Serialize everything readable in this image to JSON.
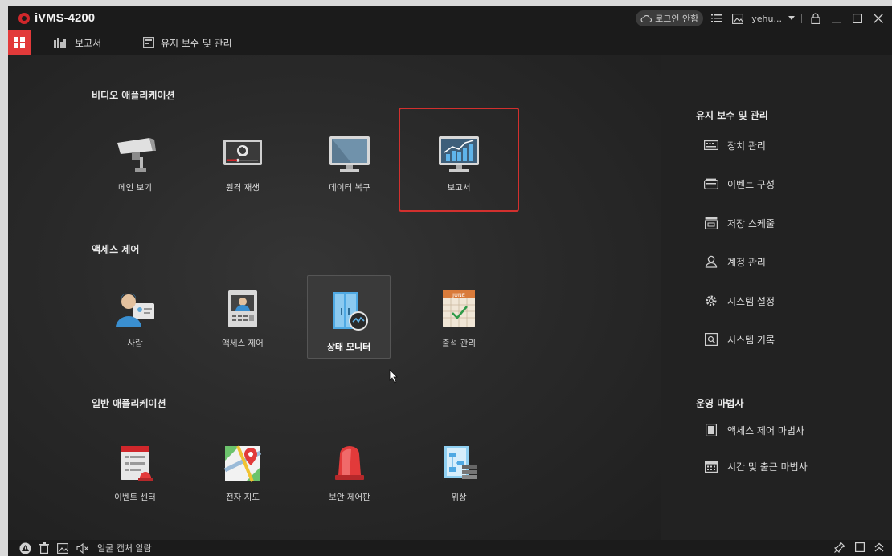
{
  "app": {
    "title": "iVMS-4200"
  },
  "titlebar": {
    "login_label": "로그인 안함",
    "user_label": "yehu..."
  },
  "menu": {
    "items": [
      {
        "label": "보고서"
      },
      {
        "label": "유지 보수 및 관리"
      }
    ]
  },
  "sections": {
    "video": {
      "title": "비디오 애플리케이션",
      "tiles": [
        {
          "label": "메인 보기"
        },
        {
          "label": "원격 재생"
        },
        {
          "label": "데이터 복구"
        },
        {
          "label": "보고서"
        }
      ]
    },
    "access": {
      "title": "액세스 제어",
      "tiles": [
        {
          "label": "사람"
        },
        {
          "label": "액세스 제어"
        },
        {
          "label": "상태 모니터"
        },
        {
          "label": "출석 관리"
        }
      ]
    },
    "general": {
      "title": "일반 애플리케이션",
      "tiles": [
        {
          "label": "이벤트 센터"
        },
        {
          "label": "전자 지도"
        },
        {
          "label": "보안 제어판"
        },
        {
          "label": "위상"
        }
      ]
    }
  },
  "right_panel": {
    "maintenance": {
      "title": "유지 보수 및 관리",
      "items": [
        {
          "label": "장치 관리"
        },
        {
          "label": "이벤트 구성"
        },
        {
          "label": "저장 스케줄"
        },
        {
          "label": "계정 관리"
        },
        {
          "label": "시스템 설정"
        },
        {
          "label": "시스템 기록"
        }
      ]
    },
    "wizard": {
      "title": "운영 마법사",
      "items": [
        {
          "label": "액세스 제어 마법사"
        },
        {
          "label": "시간 및 출근 마법사"
        }
      ]
    }
  },
  "statusbar": {
    "label": "얼굴 캡처 알람"
  },
  "calendar_icon_text": "JUNE",
  "colors": {
    "accent": "#e23a3a",
    "highlight": "#d2302e",
    "panel": "#222222",
    "titlebar": "#1b1b1b"
  }
}
